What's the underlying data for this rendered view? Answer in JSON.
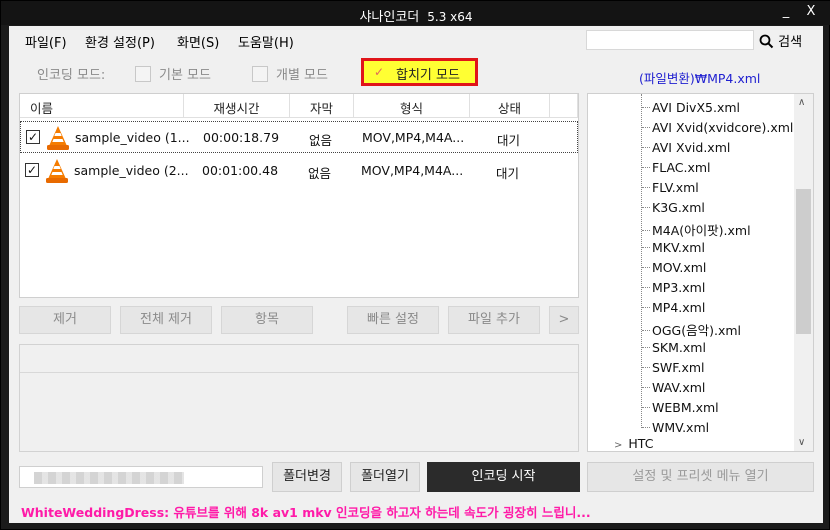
{
  "window": {
    "title": "샤나인코더",
    "version": "5.3  x64",
    "minimize": "_",
    "close": "X"
  },
  "menu": [
    {
      "label": "파일(F)"
    },
    {
      "label": "환경 설정(P)"
    },
    {
      "label": "화면(S)"
    },
    {
      "label": "도움말(H)"
    }
  ],
  "search": {
    "placeholder": "",
    "button": "검색"
  },
  "mode": {
    "label": "인코딩 모드:",
    "basic": "기본 모드",
    "individual": "개별 모드",
    "merge": "합치기 모드",
    "merge_checked": true
  },
  "preset_path": "(파일변환)₩MP4.xml",
  "table": {
    "headers": [
      "이름",
      "재생시간",
      "자막",
      "형식",
      "상태"
    ],
    "rows": [
      {
        "name": "sample_video (1...",
        "duration": "00:00:18.79",
        "subtitle": "없음",
        "format": "MOV,MP4,M4A...",
        "status": "대기",
        "checked": true
      },
      {
        "name": "sample_video (2...",
        "duration": "00:01:00.48",
        "subtitle": "없음",
        "format": "MOV,MP4,M4A...",
        "status": "대기",
        "checked": true
      }
    ]
  },
  "buttons": {
    "remove": "제거",
    "remove_all": "전체 제거",
    "item": "항목",
    "quick_settings": "빠른 설정",
    "add_file": "파일 추가",
    "more": ">"
  },
  "tree": {
    "items": [
      "AVI  DivX5.xml",
      "AVI  Xvid(xvidcore).xml",
      "AVI  Xvid.xml",
      "FLAC.xml",
      "FLV.xml",
      "K3G.xml",
      "M4A(아이팟).xml",
      "MKV.xml",
      "MOV.xml",
      "MP3.xml",
      "MP4.xml",
      "OGG(음악).xml",
      "SKM.xml",
      "SWF.xml",
      "WAV.xml",
      "WEBM.xml",
      "WMV.xml"
    ],
    "group": "HTC"
  },
  "bottom": {
    "folder_change": "폴더변경",
    "folder_open": "폴더열기",
    "start": "인코딩 시작",
    "preset_menu": "설정 및 프리셋 메뉴 열기"
  },
  "status_text": "WhiteWeddingDress: 유튜브를 위해 8k av1 mkv 인코딩을 하고자 하는데 속도가 굉장히 느립니..."
}
